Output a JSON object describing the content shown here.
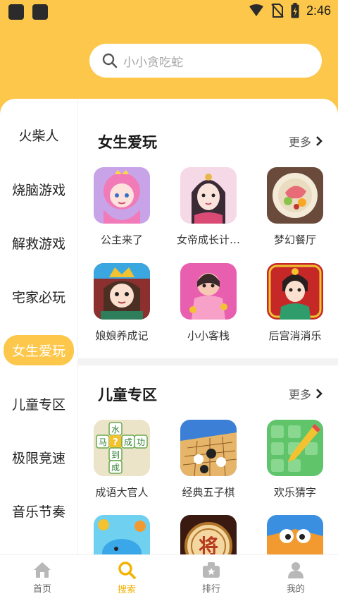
{
  "status_bar": {
    "time": "2:46"
  },
  "search": {
    "placeholder": "小小贪吃蛇"
  },
  "sidebar": {
    "items": [
      {
        "label": "火柴人"
      },
      {
        "label": "烧脑游戏"
      },
      {
        "label": "解救游戏"
      },
      {
        "label": "宅家必玩"
      },
      {
        "label": "女生爱玩",
        "active": true
      },
      {
        "label": "儿童专区"
      },
      {
        "label": "极限竞速"
      },
      {
        "label": "音乐节奏"
      }
    ]
  },
  "sections": [
    {
      "title": "女生爱玩",
      "more_label": "更多",
      "games": [
        {
          "name": "公主来了",
          "icon": "princess-game-icon"
        },
        {
          "name": "女帝成长计…",
          "icon": "empress-game-icon"
        },
        {
          "name": "梦幻餐厅",
          "icon": "restaurant-game-icon"
        },
        {
          "name": "娘娘养成记",
          "icon": "consort-game-icon"
        },
        {
          "name": "小小客栈",
          "icon": "inn-game-icon"
        },
        {
          "name": "后宫消消乐",
          "icon": "palace-match-game-icon"
        }
      ]
    },
    {
      "title": "儿童专区",
      "more_label": "更多",
      "games": [
        {
          "name": "成语大官人",
          "icon": "idiom-game-icon"
        },
        {
          "name": "经典五子棋",
          "icon": "gomoku-game-icon"
        },
        {
          "name": "欢乐猜字",
          "icon": "word-guess-game-icon"
        },
        {
          "name": "",
          "icon": "whale-game-icon"
        },
        {
          "name": "",
          "icon": "chinese-chess-game-icon"
        },
        {
          "name": "",
          "icon": "bird-game-icon"
        }
      ]
    }
  ],
  "chess_char": "将",
  "idiom_chars": [
    "水",
    "马",
    "?",
    "成",
    "功",
    "到",
    "成"
  ],
  "bottom_nav": [
    {
      "label": "首页",
      "icon": "home-icon"
    },
    {
      "label": "搜索",
      "icon": "search-icon",
      "active": true
    },
    {
      "label": "排行",
      "icon": "ranking-icon"
    },
    {
      "label": "我的",
      "icon": "profile-icon"
    }
  ],
  "colors": {
    "accent": "#fcc74a",
    "active_text": "#f3b200"
  }
}
